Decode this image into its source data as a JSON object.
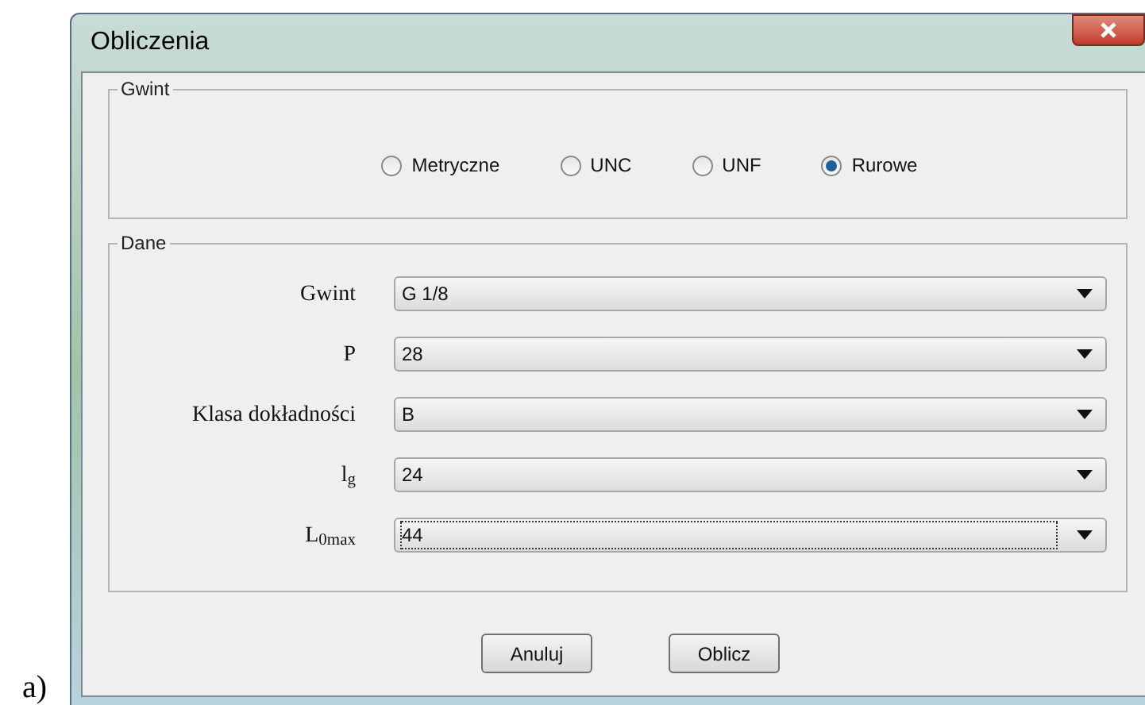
{
  "caption": "a)",
  "window": {
    "title": "Obliczenia"
  },
  "thread_group": {
    "title": "Gwint",
    "options": [
      {
        "label": "Metryczne",
        "selected": false
      },
      {
        "label": "UNC",
        "selected": false
      },
      {
        "label": "UNF",
        "selected": false
      },
      {
        "label": "Rurowe",
        "selected": true
      }
    ]
  },
  "data_group": {
    "title": "Dane",
    "fields": [
      {
        "label": "Gwint",
        "value": "G 1/8",
        "focused": false
      },
      {
        "label": "P",
        "value": "28",
        "focused": false
      },
      {
        "label": "Klasa dokładności",
        "value": "B",
        "focused": false
      },
      {
        "label": "l$_{g}$",
        "value": "24",
        "focused": false
      },
      {
        "label": "L$_{0max}$",
        "value": "44",
        "focused": true
      }
    ]
  },
  "buttons": [
    "Anuluj",
    "Oblicz"
  ]
}
